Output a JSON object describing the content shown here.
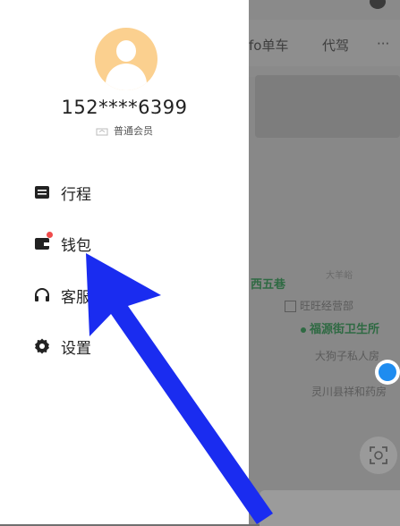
{
  "map": {
    "tabs": [
      {
        "label": "fo单车"
      },
      {
        "label": "代驾"
      },
      {
        "label": "···"
      }
    ],
    "pois": {
      "xiwuxiang": "西五巷",
      "dayangyu": "大羊峪",
      "wangwang": "旺旺经营部",
      "clinic": "福源街卫生所",
      "dagouzi": "大狗子私人房",
      "lingchuan": "灵川县祥和药房"
    }
  },
  "drawer": {
    "phone": "152****6399",
    "member_label": "普通会员",
    "menu": {
      "trip": "行程",
      "wallet": "钱包",
      "service": "客服",
      "settings": "设置"
    }
  },
  "colors": {
    "wallet_badge": "#f04b4b",
    "avatar_bg": "#fbd08f",
    "arrow": "#1a2cf0"
  }
}
